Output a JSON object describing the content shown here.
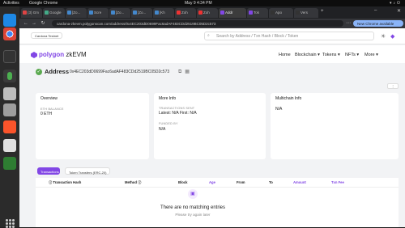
{
  "system": {
    "activities": "Activities",
    "app_name": "Google Chrome",
    "clock": "May 9  4:34 PM"
  },
  "tabs": [
    {
      "label": "(3) Gm",
      "fav": "#d44"
    },
    {
      "label": "Google",
      "fav": "#4a8"
    },
    {
      "label": "[Zo...",
      "fav": "#48c"
    },
    {
      "label": "Scre",
      "fav": "#48c"
    },
    {
      "label": "[Zo...",
      "fav": "#48c"
    },
    {
      "label": "[Zo...",
      "fav": "#48c"
    },
    {
      "label": "[Kh",
      "fav": "#48c"
    },
    {
      "label": "Zoh",
      "fav": "#e33"
    },
    {
      "label": "Zoh",
      "fav": "#e33"
    },
    {
      "label": "Addr",
      "fav": "#8247e5"
    },
    {
      "label": "Tok",
      "fav": "#8247e5"
    },
    {
      "label": "Apo",
      "fav": "#333"
    },
    {
      "label": "Vers",
      "fav": "#333"
    }
  ],
  "browser": {
    "url": "cardona-zkevm.polygonscan.com/address/0x4EC203dD0699Fac6adAF483CDd2519BC05D2c573",
    "new_chrome": "New Chrome available"
  },
  "header": {
    "testnet_badge": "Cardona Testnet",
    "search_placeholder": "Search by Address / Txn Hash / Block / Token",
    "logo_primary": "polygon",
    "logo_secondary": "zkEVM",
    "nav": [
      "Home",
      "Blockchain",
      "Tokens",
      "NFTs",
      "More"
    ]
  },
  "address": {
    "title": "Address",
    "hash": "0x4EC203dD0699Fac6adAF483CDd2519BC05D2c573",
    "filter_label": "⋮"
  },
  "overview": {
    "title": "Overview",
    "balance_label": "ETH BALANCE",
    "balance_value": "0 ETH"
  },
  "more_info": {
    "title": "More Info",
    "tx_sent_label": "TRANSACTIONS SENT",
    "tx_sent_value": "Latest: N/A   First: N/A",
    "funded_label": "FUNDED BY",
    "funded_value": "N/A"
  },
  "multichain": {
    "title": "Multichain Info",
    "value": "N/A"
  },
  "tx_tabs": {
    "active": "Transactions",
    "inactive": "Token Transfers (ERC-20)"
  },
  "table": {
    "columns": [
      "Transaction Hash",
      "Method",
      "Block",
      "Age",
      "From",
      "To",
      "Amount",
      "Txn Fee"
    ],
    "empty_title": "There are no matching entries",
    "empty_subtitle": "Please try again later"
  },
  "colors": {
    "accent": "#8247e5",
    "success": "#5aa94f"
  }
}
